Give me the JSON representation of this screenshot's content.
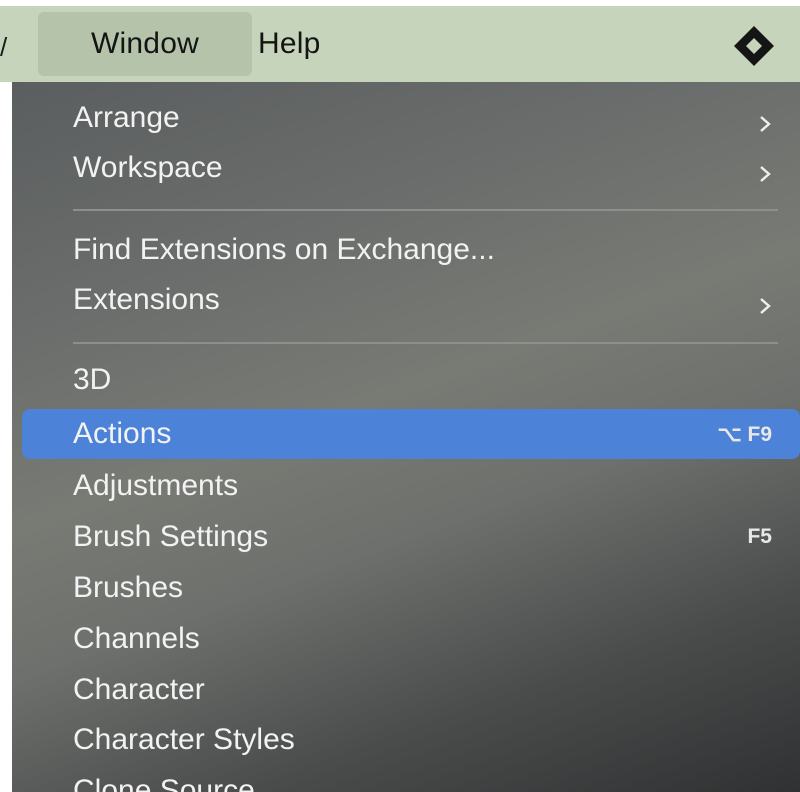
{
  "menubar": {
    "left_edge_glyph": "/",
    "items": [
      {
        "label": "Window",
        "active": true
      },
      {
        "label": "Help",
        "active": false
      }
    ],
    "app_icon": "diamond-logo-icon"
  },
  "menu": {
    "groups": [
      {
        "items": [
          {
            "label": "Arrange",
            "submenu": true,
            "shortcut": ""
          },
          {
            "label": "Workspace",
            "submenu": true,
            "shortcut": ""
          }
        ]
      },
      {
        "items": [
          {
            "label": "Find Extensions on Exchange...",
            "submenu": false,
            "shortcut": ""
          },
          {
            "label": "Extensions",
            "submenu": true,
            "shortcut": ""
          }
        ]
      },
      {
        "items": [
          {
            "label": "3D",
            "submenu": false,
            "shortcut": ""
          },
          {
            "label": "Actions",
            "submenu": false,
            "shortcut": "⌥ F9",
            "highlighted": true
          },
          {
            "label": "Adjustments",
            "submenu": false,
            "shortcut": ""
          },
          {
            "label": "Brush Settings",
            "submenu": false,
            "shortcut": "F5"
          },
          {
            "label": "Brushes",
            "submenu": false,
            "shortcut": ""
          },
          {
            "label": "Channels",
            "submenu": false,
            "shortcut": ""
          },
          {
            "label": "Character",
            "submenu": false,
            "shortcut": ""
          },
          {
            "label": "Character Styles",
            "submenu": false,
            "shortcut": ""
          },
          {
            "label": "Clone Source",
            "submenu": false,
            "shortcut": ""
          }
        ]
      }
    ]
  },
  "colors": {
    "menubar_bg": "#c6d4bb",
    "menubar_active_bg": "#b4c3a9",
    "highlight": "#4d82d9",
    "menu_text": "#f2f2f2"
  }
}
